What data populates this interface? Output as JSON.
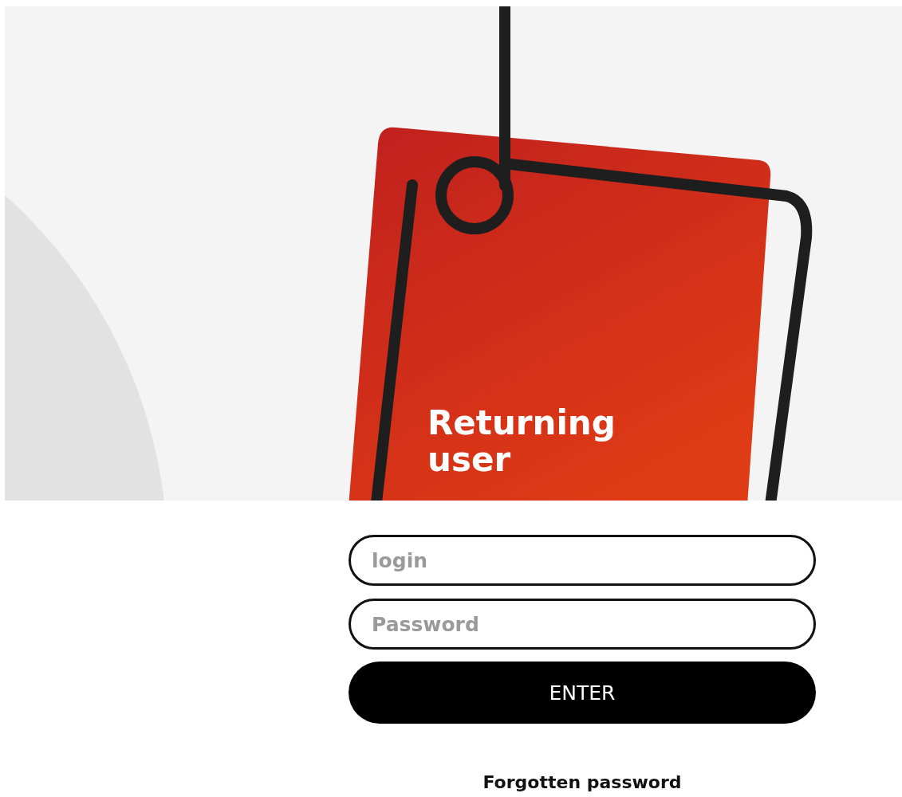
{
  "hero": {
    "title": "Returning user"
  },
  "form": {
    "fields": [
      {
        "placeholder": "login"
      },
      {
        "placeholder": "Password"
      }
    ],
    "submit": "ENTER",
    "forgot_link": "Forgotten password"
  }
}
